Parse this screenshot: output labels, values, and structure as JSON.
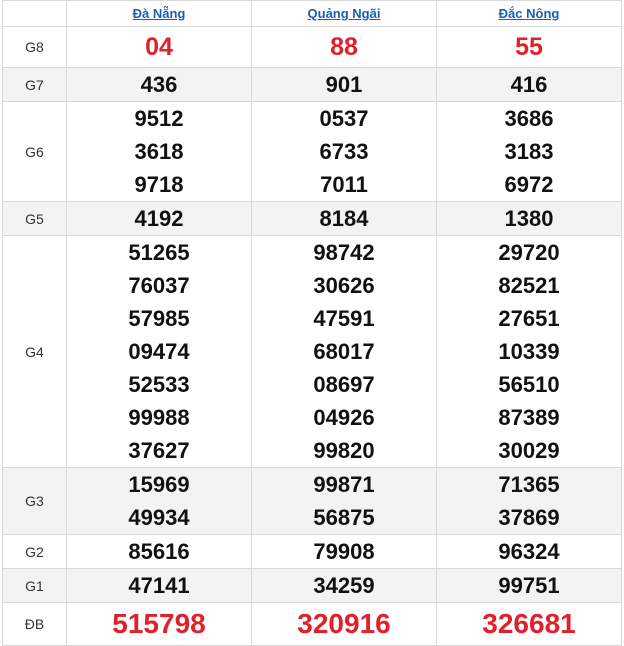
{
  "provinces": [
    "Đà Nẵng",
    "Quảng Ngãi",
    "Đắc Nông"
  ],
  "prizes": [
    {
      "label": "G8",
      "cols": [
        [
          "04"
        ],
        [
          "88"
        ],
        [
          "55"
        ]
      ]
    },
    {
      "label": "G7",
      "cols": [
        [
          "436"
        ],
        [
          "901"
        ],
        [
          "416"
        ]
      ]
    },
    {
      "label": "G6",
      "cols": [
        [
          "9512",
          "3618",
          "9718"
        ],
        [
          "0537",
          "6733",
          "7011"
        ],
        [
          "3686",
          "3183",
          "6972"
        ]
      ]
    },
    {
      "label": "G5",
      "cols": [
        [
          "4192"
        ],
        [
          "8184"
        ],
        [
          "1380"
        ]
      ]
    },
    {
      "label": "G4",
      "cols": [
        [
          "51265",
          "76037",
          "57985",
          "09474",
          "52533",
          "99988",
          "37627"
        ],
        [
          "98742",
          "30626",
          "47591",
          "68017",
          "08697",
          "04926",
          "99820"
        ],
        [
          "29720",
          "82521",
          "27651",
          "10339",
          "56510",
          "87389",
          "30029"
        ]
      ]
    },
    {
      "label": "G3",
      "cols": [
        [
          "15969",
          "49934"
        ],
        [
          "99871",
          "56875"
        ],
        [
          "71365",
          "37869"
        ]
      ]
    },
    {
      "label": "G2",
      "cols": [
        [
          "85616"
        ],
        [
          "79908"
        ],
        [
          "96324"
        ]
      ]
    },
    {
      "label": "G1",
      "cols": [
        [
          "47141"
        ],
        [
          "34259"
        ],
        [
          "99751"
        ]
      ]
    },
    {
      "label": "ĐB",
      "cols": [
        [
          "515798"
        ],
        [
          "320916"
        ],
        [
          "326681"
        ]
      ]
    }
  ],
  "colors": {
    "highlight": "#e0202a",
    "link": "#1a5fb4",
    "alt_row": "#f3f3f3",
    "border": "#d9d9d9"
  }
}
